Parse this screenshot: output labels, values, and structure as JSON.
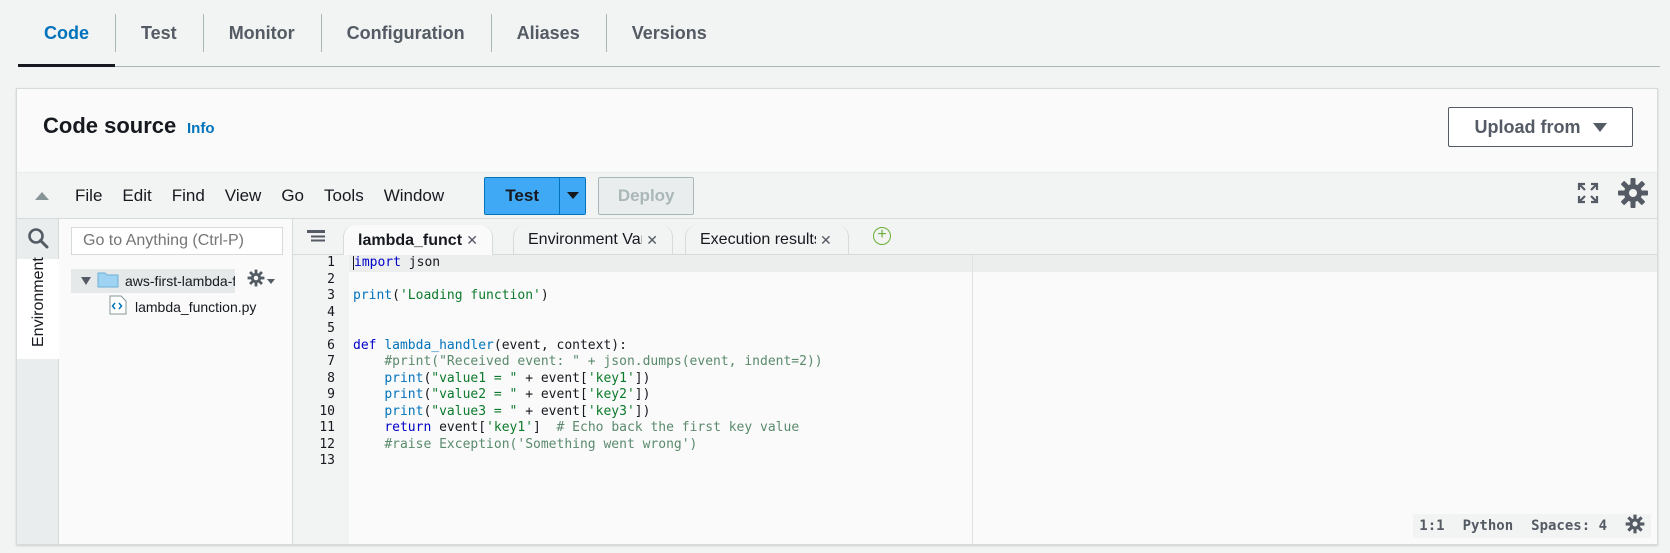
{
  "tabs": [
    {
      "label": "Code",
      "active": true
    },
    {
      "label": "Test",
      "active": false
    },
    {
      "label": "Monitor",
      "active": false
    },
    {
      "label": "Configuration",
      "active": false
    },
    {
      "label": "Aliases",
      "active": false
    },
    {
      "label": "Versions",
      "active": false
    }
  ],
  "panel": {
    "title": "Code source",
    "info_link": "Info",
    "upload_label": "Upload from"
  },
  "toolbar": {
    "menu": [
      "File",
      "Edit",
      "Find",
      "View",
      "Go",
      "Tools",
      "Window"
    ],
    "test_label": "Test",
    "deploy_label": "Deploy",
    "deploy_enabled": false
  },
  "sidebar": {
    "environment_label": "Environment",
    "goto_placeholder": "Go to Anything (Ctrl-P)",
    "folder_name": "aws-first-lambda-fur",
    "file_name": "lambda_function.py"
  },
  "editor_tabs": [
    {
      "label": "lambda_function",
      "active": true
    },
    {
      "label": "Environment Var",
      "active": false
    },
    {
      "label": "Execution results",
      "active": false
    }
  ],
  "code": {
    "line_numbers": [
      "1",
      "2",
      "3",
      "4",
      "5",
      "6",
      "7",
      "8",
      "9",
      "10",
      "11",
      "12",
      "13"
    ],
    "current_line": 1
  },
  "status": {
    "position": "1:1",
    "language": "Python",
    "indent": "Spaces: 4"
  },
  "colors": {
    "accent": "#0073bb",
    "test_button": "#3fa9f5",
    "add_tab": "#6aaf35"
  }
}
